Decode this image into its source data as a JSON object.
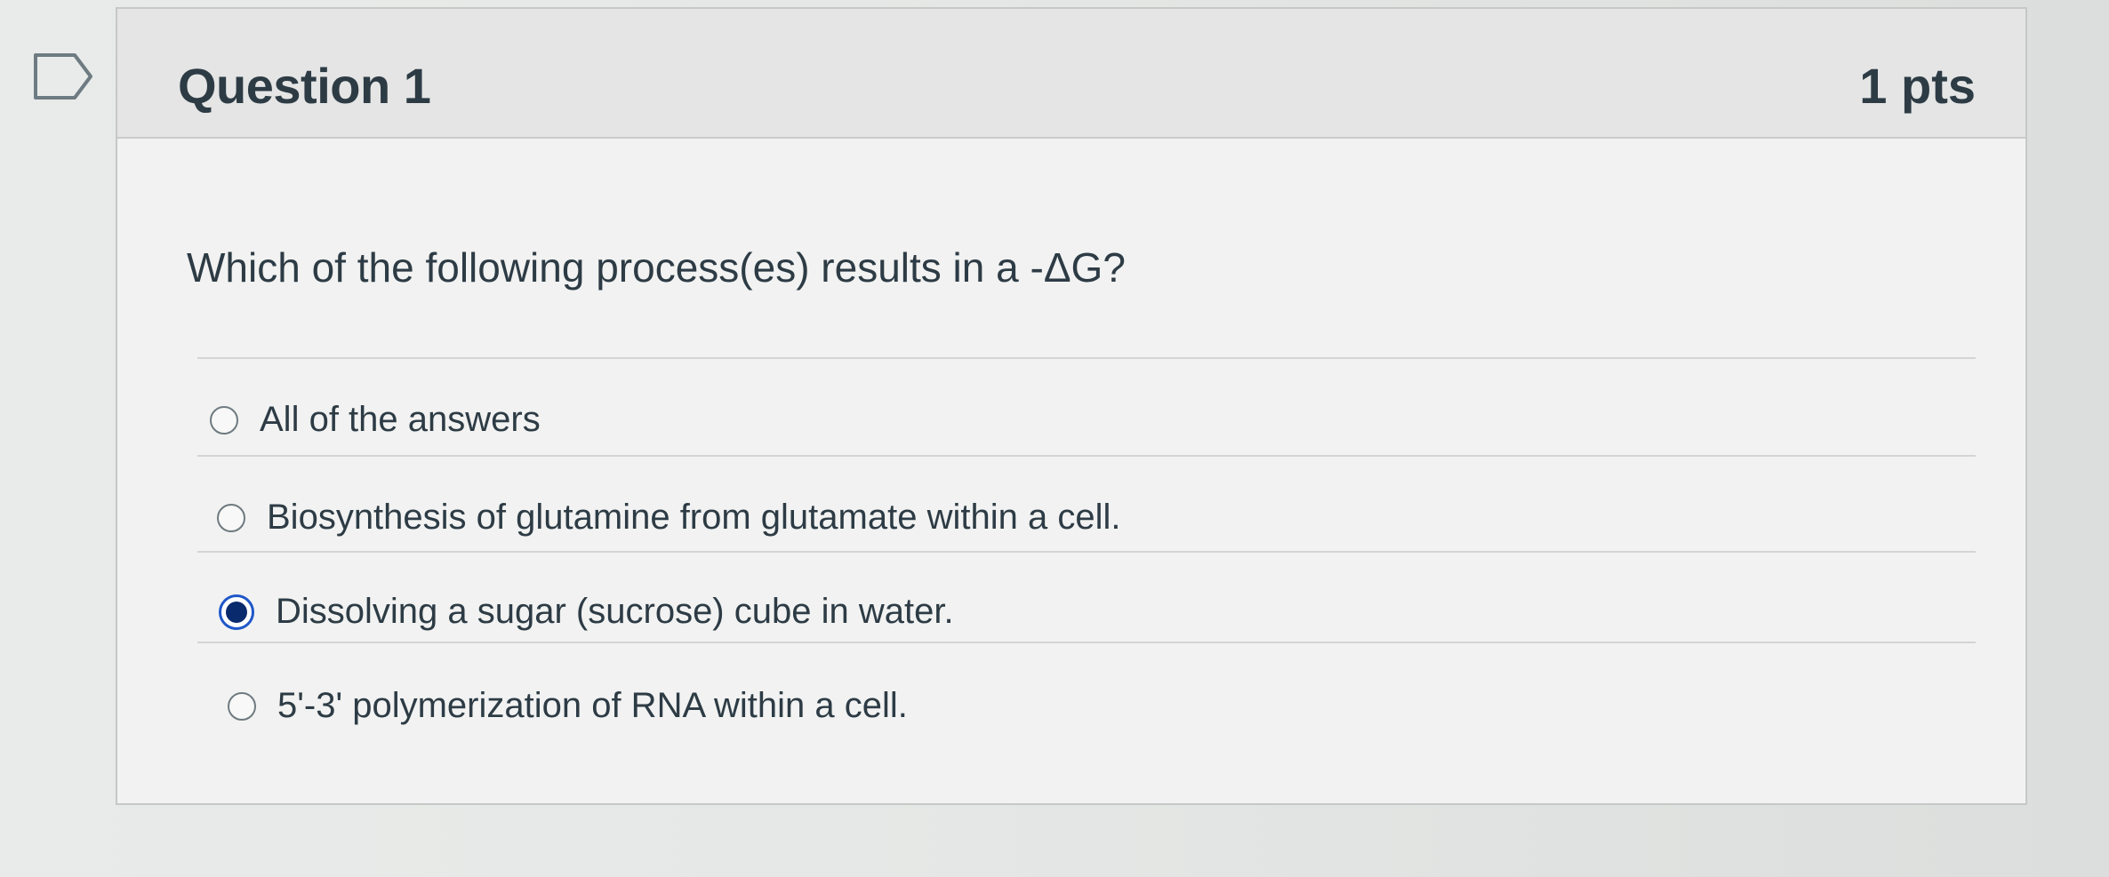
{
  "question": {
    "title": "Question 1",
    "points": "1 pts",
    "text": "Which of the following process(es) results in a -ΔG?",
    "answers": [
      {
        "label": "All of the answers",
        "selected": false
      },
      {
        "label": "Biosynthesis of glutamine from glutamate within a cell.",
        "selected": false
      },
      {
        "label": "Dissolving a sugar (sucrose) cube in water.",
        "selected": true
      },
      {
        "label": "5'-3' polymerization of RNA within a cell.",
        "selected": false
      }
    ]
  },
  "colors": {
    "text": "#2d3b45",
    "selected_radio": "#1f57c9",
    "header_bg": "#e4e5e4",
    "card_border": "#c6c8c7"
  },
  "icons": {
    "flag": "flag-outline-icon"
  }
}
